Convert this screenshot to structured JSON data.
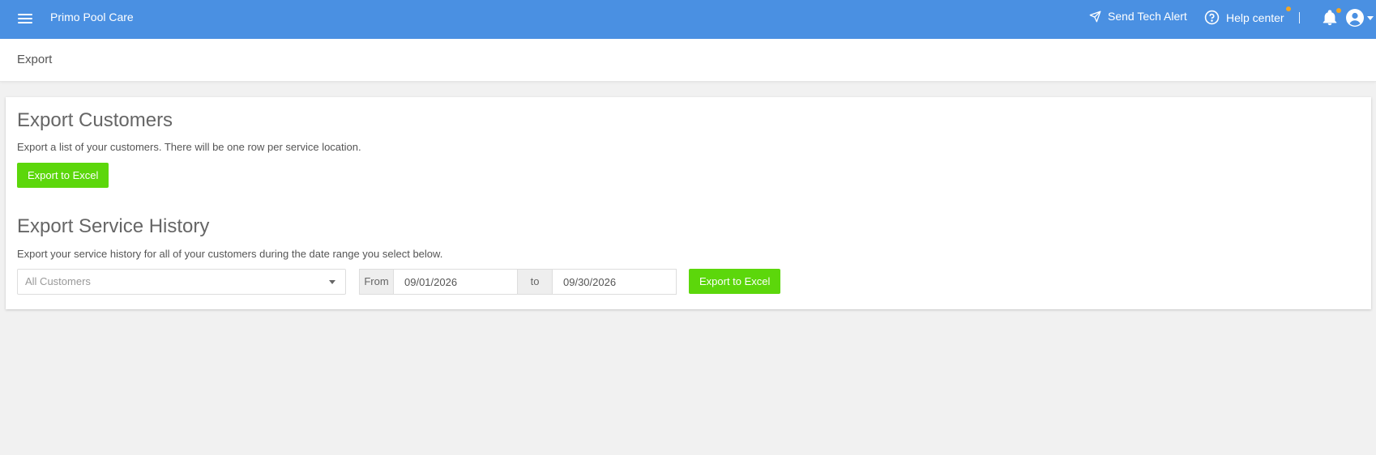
{
  "topbar": {
    "app_name": "Primo Pool Care",
    "menu_icon": "hamburger-menu-icon",
    "send_tech_alert": "Send Tech Alert",
    "help_center": "Help center",
    "bell_icon": "bell-icon",
    "user_icon": "user-account-icon",
    "bg_color": "#4a90e2",
    "badge_color": "#f5a623"
  },
  "page": {
    "title": "Export"
  },
  "export_customers": {
    "title": "Export Customers",
    "description": "Export a list of your customers. There will be one row per service location.",
    "button_label": "Export to Excel"
  },
  "export_service_history": {
    "title": "Export Service History",
    "description": "Export your service history for all of your customers during the date range you select below.",
    "customer_select": "All Customers",
    "from_label": "From",
    "from_date": "09/01/2026",
    "to_label": "to",
    "to_date": "09/30/2026",
    "button_label": "Export to Excel",
    "button_color": "#5cd70b"
  }
}
